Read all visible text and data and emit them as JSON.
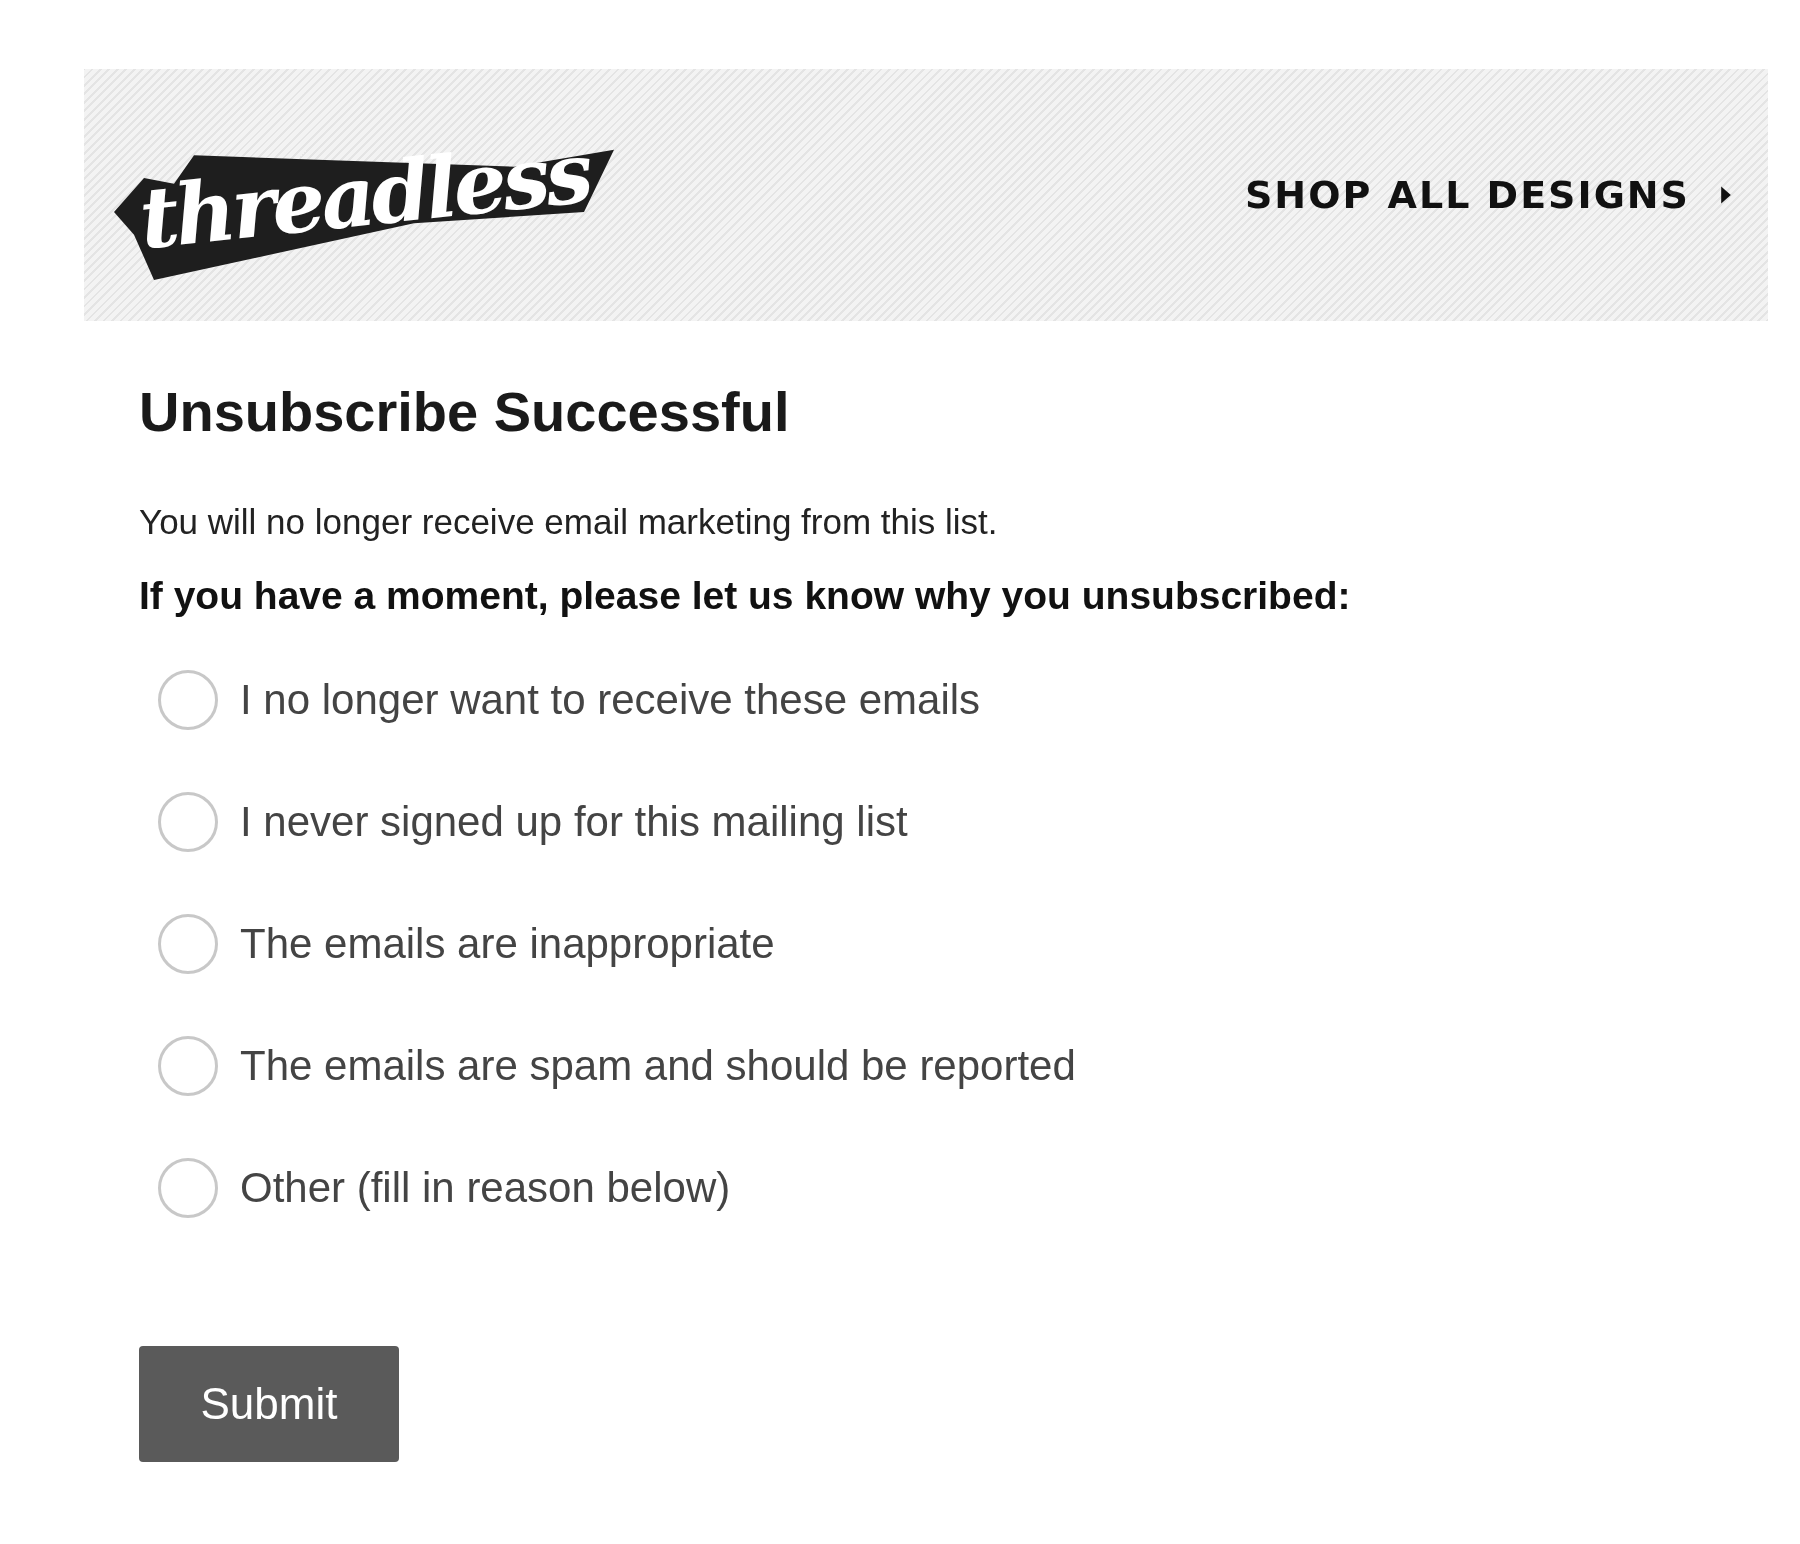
{
  "header": {
    "logo": "threadless",
    "nav_link": "SHOP ALL DESIGNS"
  },
  "title": "Unsubscribe Successful",
  "message": "You will no longer receive email marketing from this list.",
  "question": "If you have a moment, please let us know why you unsubscribed:",
  "reasons": [
    {
      "label": "I no longer want to receive these emails",
      "selected": false
    },
    {
      "label": "I never signed up for this mailing list",
      "selected": false
    },
    {
      "label": "The emails are inappropriate",
      "selected": false
    },
    {
      "label": "The emails are spam and should be reported",
      "selected": false
    },
    {
      "label": "Other (fill in reason below)",
      "selected": false
    }
  ],
  "submit_button": "Submit"
}
